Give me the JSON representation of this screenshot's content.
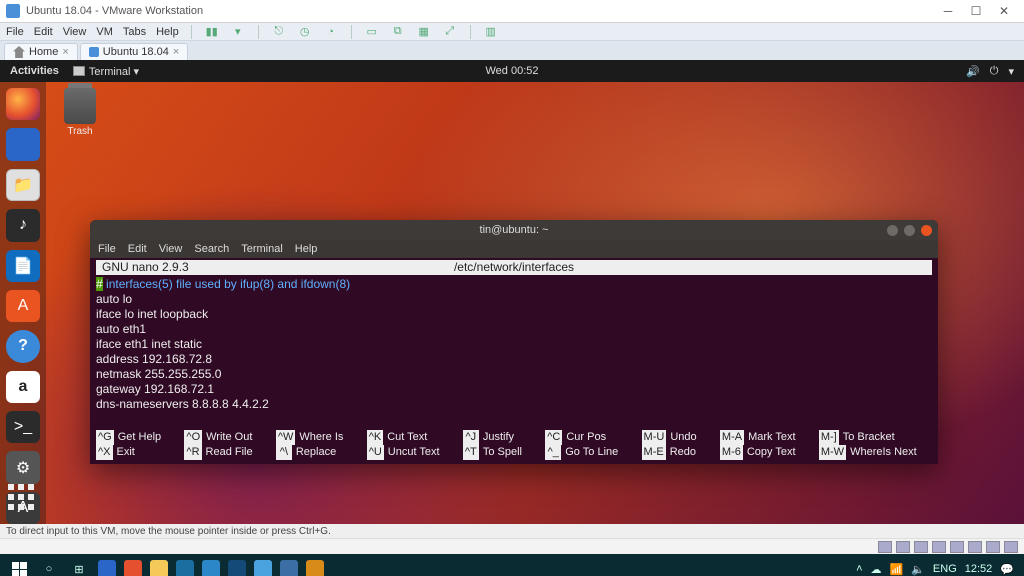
{
  "win": {
    "title": "Ubuntu 18.04 - VMware Workstation",
    "menu": [
      "File",
      "Edit",
      "View",
      "VM",
      "Tabs",
      "Help"
    ],
    "tabs": {
      "home": "Home",
      "vm": "Ubuntu 18.04"
    },
    "status": "To direct input to this VM, move the mouse pointer inside or press Ctrl+G.",
    "tray": {
      "lang": "ENG",
      "time": "12:52"
    }
  },
  "gnome": {
    "activities": "Activities",
    "appmenu": "Terminal ▾",
    "clock": "Wed 00:52",
    "trash": "Trash"
  },
  "term": {
    "title": "tin@ubuntu: ~",
    "menu": [
      "File",
      "Edit",
      "View",
      "Search",
      "Terminal",
      "Help"
    ],
    "nano": {
      "app": "GNU nano 2.9.3",
      "file": "/etc/network/interfaces",
      "comment": " interfaces(5) file used by ifup(8) and ifdown(8)",
      "lines": [
        "auto lo",
        "iface lo inet loopback",
        "auto eth1",
        "iface eth1 inet static",
        "address 192.168.72.8",
        "netmask 255.255.255.0",
        "gateway 192.168.72.1",
        "dns-nameservers 8.8.8.8 4.4.2.2"
      ],
      "shortcuts": [
        [
          "^G",
          "Get Help"
        ],
        [
          "^O",
          "Write Out"
        ],
        [
          "^W",
          "Where Is"
        ],
        [
          "^K",
          "Cut Text"
        ],
        [
          "^J",
          "Justify"
        ],
        [
          "^C",
          "Cur Pos"
        ],
        [
          "M-U",
          "Undo"
        ],
        [
          "^X",
          "Exit"
        ],
        [
          "^R",
          "Read File"
        ],
        [
          "^\\",
          "Replace"
        ],
        [
          "^U",
          "Uncut Text"
        ],
        [
          "^T",
          "To Spell"
        ],
        [
          "^_",
          "Go To Line"
        ],
        [
          "M-E",
          "Redo"
        ],
        [
          "M-A",
          "Mark Text"
        ],
        [
          "M-]",
          "To Bracket"
        ],
        [
          "M-6",
          "Copy Text"
        ],
        [
          "M-W",
          "WhereIs Next"
        ]
      ]
    }
  }
}
